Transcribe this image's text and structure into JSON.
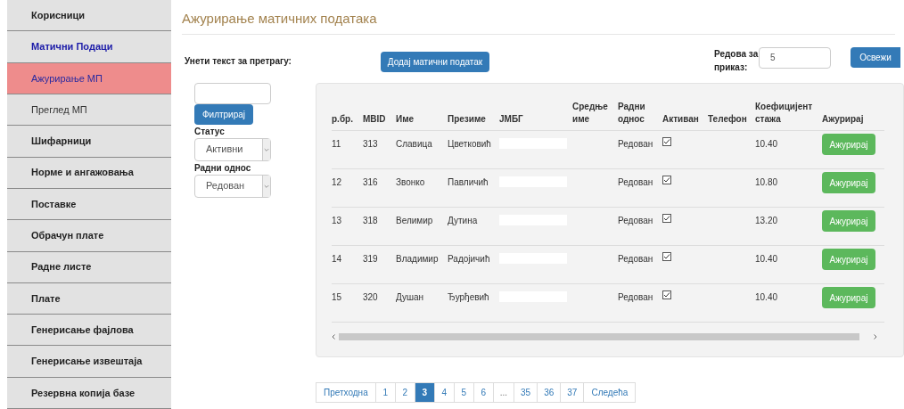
{
  "sidebar": {
    "items": [
      {
        "label": "Корисници",
        "kind": "section",
        "expanded": false,
        "selected": false
      },
      {
        "label": "Матични Подаци",
        "kind": "section",
        "expanded": true,
        "selected": false
      },
      {
        "label": "Ажурирање МП",
        "kind": "subitem",
        "selected": true
      },
      {
        "label": "Преглед МП",
        "kind": "subitem",
        "selected": false
      },
      {
        "label": "Шифарници",
        "kind": "section",
        "expanded": false,
        "selected": false
      },
      {
        "label": "Норме и ангажовања",
        "kind": "section",
        "expanded": false,
        "selected": false
      },
      {
        "label": "Поставке",
        "kind": "section",
        "expanded": false,
        "selected": false
      },
      {
        "label": "Обрачун плате",
        "kind": "section",
        "expanded": false,
        "selected": false
      },
      {
        "label": "Радне листе",
        "kind": "section",
        "expanded": false,
        "selected": false
      },
      {
        "label": "Плате",
        "kind": "section",
        "expanded": false,
        "selected": false
      },
      {
        "label": "Генерисање фајлова",
        "kind": "section",
        "expanded": false,
        "selected": false
      },
      {
        "label": "Генерисање извештаја",
        "kind": "section",
        "expanded": false,
        "selected": false
      },
      {
        "label": "Резервна копија базе",
        "kind": "section",
        "expanded": false,
        "selected": false
      }
    ]
  },
  "page_title": "Ажурирање матичних података",
  "filters": {
    "search_label": "Унети текст за претрагу:",
    "filter_button": "Филтрирај",
    "status_label": "Статус",
    "status_value": "Активни",
    "relation_label": "Радни однос",
    "relation_value": "Редован"
  },
  "add_button": "Додај матични податак",
  "rows_per_page": {
    "label": "Редова за приказ:",
    "value": "5"
  },
  "refresh_button": "Освежи",
  "table": {
    "columns": [
      "р.бр.",
      "MBID",
      "Име",
      "Презиме",
      "ЈМБГ",
      "Средње име",
      "Радни однос",
      "Активан",
      "Телефон",
      "Коефицијент стажа",
      "Ажурирај"
    ],
    "rows": [
      {
        "no": "11",
        "mbid": "313",
        "first": "Славица",
        "last": "Цветковић",
        "relation": "Редован",
        "active": true,
        "coef": "10.40",
        "action": "Ажурирај"
      },
      {
        "no": "12",
        "mbid": "316",
        "first": "Звонко",
        "last": "Павличић",
        "relation": "Редован",
        "active": true,
        "coef": "10.80",
        "action": "Ажурирај"
      },
      {
        "no": "13",
        "mbid": "318",
        "first": "Велимир",
        "last": "Дутина",
        "relation": "Редован",
        "active": true,
        "coef": "13.20",
        "action": "Ажурирај"
      },
      {
        "no": "14",
        "mbid": "319",
        "first": "Владимир",
        "last": "Радојичић",
        "relation": "Редован",
        "active": true,
        "coef": "10.40",
        "action": "Ажурирај"
      },
      {
        "no": "15",
        "mbid": "320",
        "first": "Душан",
        "last": "Ђурђевић",
        "relation": "Редован",
        "active": true,
        "coef": "10.40",
        "action": "Ажурирај"
      }
    ]
  },
  "pagination": [
    {
      "label": "Претходна",
      "kind": "nav",
      "selected": false
    },
    {
      "label": "1",
      "kind": "page",
      "selected": false
    },
    {
      "label": "2",
      "kind": "page",
      "selected": false
    },
    {
      "label": "3",
      "kind": "page",
      "selected": true
    },
    {
      "label": "4",
      "kind": "page",
      "selected": false
    },
    {
      "label": "5",
      "kind": "page",
      "selected": false
    },
    {
      "label": "6",
      "kind": "page",
      "selected": false
    },
    {
      "label": "...",
      "kind": "ellipsis",
      "selected": false
    },
    {
      "label": "35",
      "kind": "page",
      "selected": false
    },
    {
      "label": "36",
      "kind": "page",
      "selected": false
    },
    {
      "label": "37",
      "kind": "page",
      "selected": false
    },
    {
      "label": "Следећа",
      "kind": "nav",
      "selected": false
    }
  ]
}
